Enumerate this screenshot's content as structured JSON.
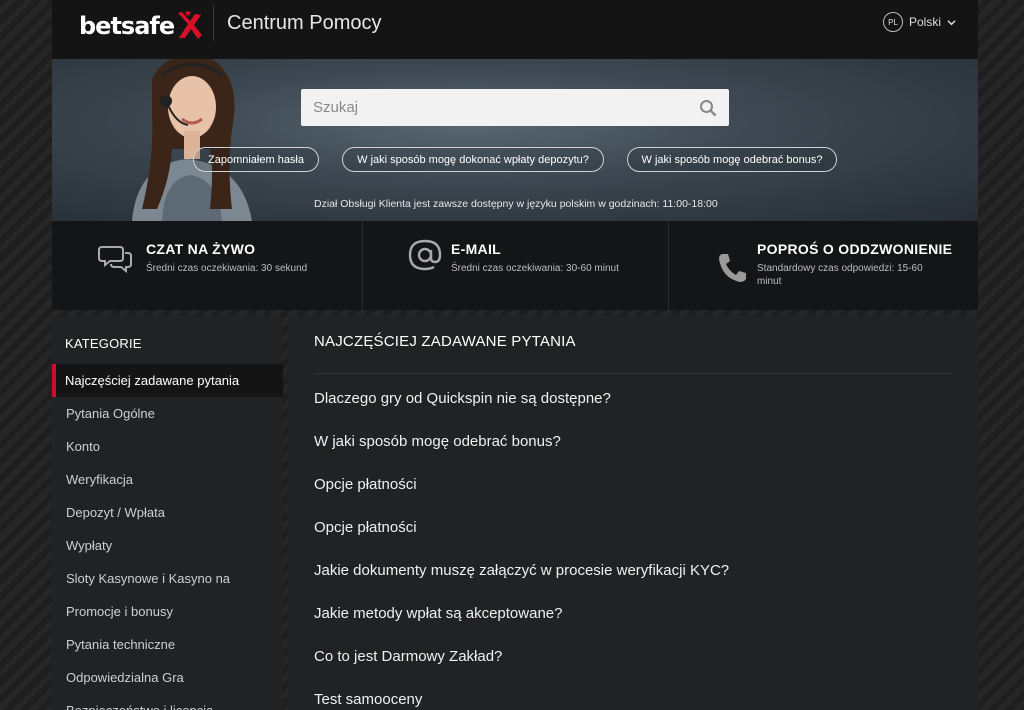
{
  "header": {
    "logo_text": "betsafe",
    "site_title": "Centrum Pomocy",
    "lang_code": "PL",
    "lang_label": "Polski"
  },
  "hero": {
    "search_placeholder": "Szukaj",
    "quick_links": [
      "Zapomniałem hasła",
      "W jaki sposób mogę dokonać wpłaty depozytu?",
      "W jaki sposób mogę odebrać bonus?"
    ],
    "note": "Dział Obsługi Klienta jest zawsze dostępny w języku polskim w godzinach: 11:00-18:00"
  },
  "contacts": [
    {
      "title": "CZAT NA ŻYWO",
      "sub": "Średni czas oczekiwania: 30 sekund",
      "icon": "chat-icon"
    },
    {
      "title": "E-MAIL",
      "sub": "Średni czas oczekiwania: 30-60 minut",
      "icon": "at-icon"
    },
    {
      "title": "POPROŚ O ODDZWONIENIE",
      "sub": "Standardowy czas odpowiedzi: 15-60 minut",
      "icon": "phone-icon"
    }
  ],
  "sidebar": {
    "heading": "KATEGORIE",
    "items": [
      "Najczęściej zadawane pytania",
      "Pytania Ogólne",
      "Konto",
      "Weryfikacja",
      "Depozyt / Wpłata",
      "Wypłaty",
      "Sloty Kasynowe i Kasyno na",
      "Promocje i bonusy",
      "Pytania techniczne",
      "Odpowiedzialna Gra",
      "Bezpieczeństwo i licencja"
    ]
  },
  "main": {
    "title": "NAJCZĘŚCIEJ ZADAWANE PYTANIA",
    "questions": [
      "Dlaczego gry od Quickspin nie są dostępne?",
      "W jaki sposób mogę odebrać bonus?",
      "Opcje płatności",
      "Opcje płatności",
      "Jakie dokumenty muszę załączyć w procesie weryfikacji KYC?",
      "Jakie metody wpłat są akceptowane?",
      "Co to jest Darmowy Zakład?",
      "Test samooceny"
    ]
  },
  "colors": {
    "accent": "#c8102e",
    "panel": "#202224",
    "header": "#141414"
  }
}
